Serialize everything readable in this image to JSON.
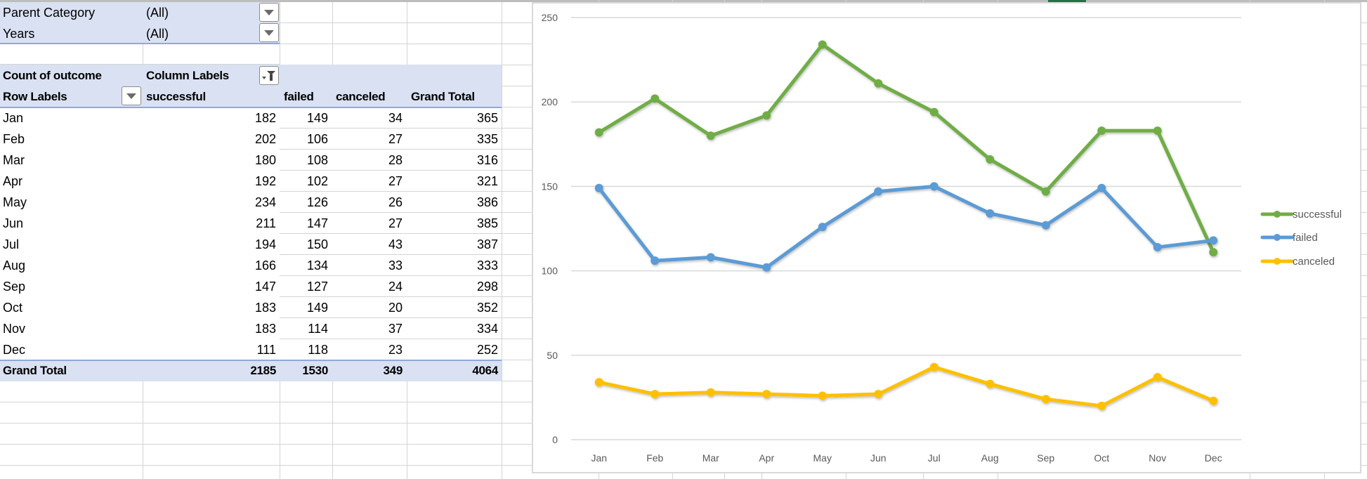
{
  "pivot": {
    "filters": [
      {
        "label": "Parent Category",
        "value": "(All)"
      },
      {
        "label": "Years",
        "value": "(All)"
      }
    ],
    "header": {
      "value_label": "Count of outcome",
      "column_labels": "Column Labels",
      "row_labels": "Row Labels",
      "columns": [
        "successful",
        "failed",
        "canceled",
        "Grand Total"
      ]
    },
    "rows": [
      {
        "label": "Jan",
        "values": [
          "182",
          "149",
          "34",
          "365"
        ]
      },
      {
        "label": "Feb",
        "values": [
          "202",
          "106",
          "27",
          "335"
        ]
      },
      {
        "label": "Mar",
        "values": [
          "180",
          "108",
          "28",
          "316"
        ]
      },
      {
        "label": "Apr",
        "values": [
          "192",
          "102",
          "27",
          "321"
        ]
      },
      {
        "label": "May",
        "values": [
          "234",
          "126",
          "26",
          "386"
        ]
      },
      {
        "label": "Jun",
        "values": [
          "211",
          "147",
          "27",
          "385"
        ]
      },
      {
        "label": "Jul",
        "values": [
          "194",
          "150",
          "43",
          "387"
        ]
      },
      {
        "label": "Aug",
        "values": [
          "166",
          "134",
          "33",
          "333"
        ]
      },
      {
        "label": "Sep",
        "values": [
          "147",
          "127",
          "24",
          "298"
        ]
      },
      {
        "label": "Oct",
        "values": [
          "183",
          "149",
          "20",
          "352"
        ]
      },
      {
        "label": "Nov",
        "values": [
          "183",
          "114",
          "37",
          "334"
        ]
      },
      {
        "label": "Dec",
        "values": [
          "111",
          "118",
          "23",
          "252"
        ]
      }
    ],
    "grand_total": {
      "label": "Grand Total",
      "values": [
        "2185",
        "1530",
        "349",
        "4064"
      ]
    },
    "icons": {
      "filter_dropdown": "dropdown-arrow-icon",
      "column_filter": "filter-active-icon"
    }
  },
  "chart_data": {
    "type": "line",
    "title": "",
    "xlabel": "",
    "ylabel": "",
    "categories": [
      "Jan",
      "Feb",
      "Mar",
      "Apr",
      "May",
      "Jun",
      "Jul",
      "Aug",
      "Sep",
      "Oct",
      "Nov",
      "Dec"
    ],
    "series": [
      {
        "name": "successful",
        "color": "#70AD47",
        "values": [
          182,
          202,
          180,
          192,
          234,
          211,
          194,
          166,
          147,
          183,
          183,
          111
        ]
      },
      {
        "name": "failed",
        "color": "#5B9BD5",
        "values": [
          149,
          106,
          108,
          102,
          126,
          147,
          150,
          134,
          127,
          149,
          114,
          118
        ]
      },
      {
        "name": "canceled",
        "color": "#FFC000",
        "values": [
          34,
          27,
          28,
          27,
          26,
          27,
          43,
          33,
          24,
          20,
          37,
          23
        ]
      }
    ],
    "ylim": [
      0,
      250
    ],
    "yticks": [
      0,
      50,
      100,
      150,
      200,
      250
    ],
    "grid": true,
    "legend": "right",
    "markers": true
  }
}
